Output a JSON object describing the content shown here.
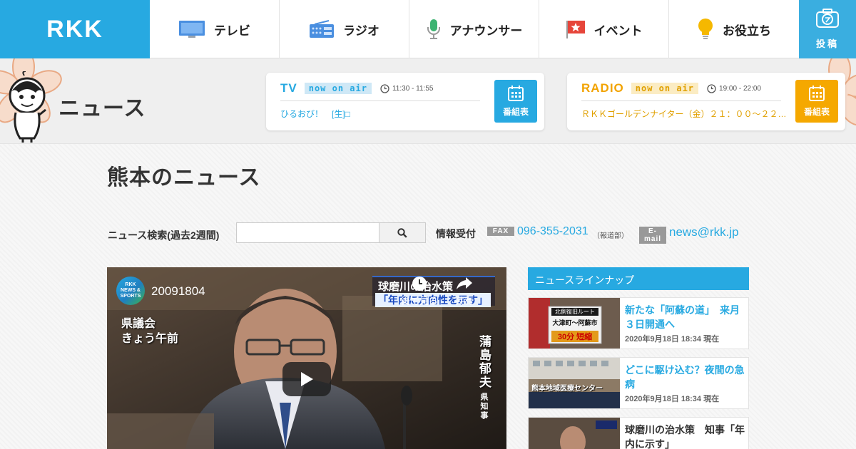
{
  "brand": {
    "logo_text": "RKK"
  },
  "nav": {
    "items": [
      {
        "label": "テレビ",
        "icon": "tv-icon"
      },
      {
        "label": "ラジオ",
        "icon": "radio-icon"
      },
      {
        "label": "アナウンサー",
        "icon": "microphone-icon"
      },
      {
        "label": "イベント",
        "icon": "flag-icon"
      },
      {
        "label": "お役立ち",
        "icon": "lightbulb-icon"
      }
    ],
    "post_label": "投稿"
  },
  "section": {
    "title": "ニュース"
  },
  "onair": {
    "tv": {
      "label": "TV",
      "badge": "now on air",
      "time": "11:30 - 11:55",
      "program": "ひるおび！　[生]□",
      "schedule_label": "番組表"
    },
    "radio": {
      "label": "RADIO",
      "badge": "now on air",
      "time": "19:00 - 22:00",
      "program": "ＲＫＫゴールデンナイター（金）２１：００～２２：０…",
      "schedule_label": "番組表"
    }
  },
  "page": {
    "title": "熊本のニュース"
  },
  "search": {
    "label": "ニュース検索(過去2週間)",
    "value": "",
    "placeholder": ""
  },
  "contact": {
    "label": "情報受付",
    "fax_tag": "FAX",
    "fax_number": "096-355-2031",
    "fax_dept": "（報道部）",
    "email_tag": "E-mail",
    "email": "news@rkk.jp"
  },
  "video": {
    "channel_logo_line1": "RKK",
    "channel_logo_line2": "NEWS &",
    "channel_logo_line3": "SPORTS",
    "title": "20091804",
    "watch_later": "後で見る",
    "share": "共有",
    "caption_line1": "県議会",
    "caption_line2": "きょう午前",
    "banner_line1": "球磨川の治水策",
    "banner_line2": "「年内に方向性を示す」",
    "speaker_name": "蒲島郁夫",
    "speaker_role": "県知事"
  },
  "lineup": {
    "title": "ニュースラインナップ",
    "items": [
      {
        "headline": "新たな「阿蘇の道」　来月３日開通へ",
        "date": "2020年9月18日 18:34 現在"
      },
      {
        "headline": "どこに駆け込む？夜間の急病",
        "date": "2020年9月18日 18:34 現在"
      },
      {
        "headline": "球磨川の治水策　知事「年内に示す」",
        "date": ""
      }
    ]
  },
  "thumb1": {
    "line1": "北側復旧ルート",
    "line2": "大津町～阿蘇市",
    "line3": "30分 短縮"
  },
  "thumb2": {
    "line1": "熊本地域医療センター"
  },
  "colors": {
    "accent_blue": "#27a9e1",
    "radio_orange": "#f5a800"
  }
}
